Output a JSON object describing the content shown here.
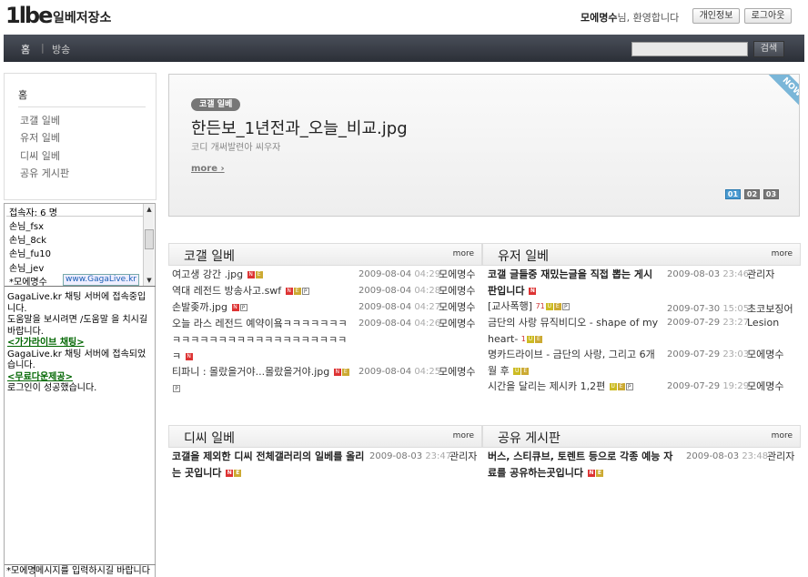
{
  "header": {
    "logo": "1lbe",
    "site_name": "일베저장소",
    "welcome_user": "모에명수",
    "welcome_suffix": "님, 환영합니다",
    "profile_button": "개인정보",
    "logout_button": "로그아웃"
  },
  "nav": {
    "home": "홈",
    "separator": "|",
    "broadcast": "방송",
    "search_button": "검색"
  },
  "sidebar": {
    "home": "홈",
    "items": [
      {
        "label": "코갤 일베"
      },
      {
        "label": "유저 일베"
      },
      {
        "label": "디씨 일베"
      },
      {
        "label": "공유 게시판"
      }
    ]
  },
  "chat": {
    "user_count": "접속자: 6 명",
    "users": [
      "손님_fsx",
      "손님_8ck",
      "손님_fu10",
      "손님_jev",
      "*모에명수"
    ],
    "gagalive_link": "www.GagaLive.kr",
    "messages": {
      "m1": "GagaLive.kr 채팅 서버에 접속중입니다.",
      "m2": "도움말을 보시려면 /도움말 을 치시길 바랍니다.",
      "link1": "<가가라이브 채팅>",
      "m3": "GagaLive.kr 채팅 서버에 접속되었습니다.",
      "link2": "<무료다운제공>",
      "m4": "로그인이 성공했습니다."
    },
    "input_name": "*모에명",
    "input_placeholder": "메시지를 입력하시길 바랍니다"
  },
  "featured": {
    "badge": "코갤 일베",
    "title": "한든보_1년전과_오늘_비교.jpg",
    "subtitle": "코디 개써발련아 씨우자",
    "more": "more ›",
    "ribbon": "NOW",
    "pages": [
      "01",
      "02",
      "03"
    ]
  },
  "boards": {
    "kogal": {
      "title": "코갤 일베",
      "more": "more",
      "rows": [
        {
          "title": "여고생 강간 .jpg",
          "date": "2009-08-04",
          "time": "04:29",
          "author": "모에명수"
        },
        {
          "title": "역대 레전드 방송사고.swf",
          "date": "2009-08-04",
          "time": "04:28",
          "author": "모에명수"
        },
        {
          "title": "손발좆까.jpg",
          "date": "2009-08-04",
          "time": "04:27",
          "author": "모에명수"
        },
        {
          "title": "오늘 라스 레전드 예약이욬ㅋㅋㅋㅋㅋㅋㅋㅋㅋㅋㅋㅋㅋㅋㅋㅋㅋㅋㅋㅋㅋㅋㅋㅋㅋㅋㅋ",
          "date": "2009-08-04",
          "time": "04:26",
          "author": "모에명수"
        },
        {
          "title": "티파니 : 몰랐을거야...몰랐을거야.jpg",
          "date": "2009-08-04",
          "time": "04:25",
          "author": "모에명수"
        }
      ]
    },
    "user": {
      "title": "유저 일베",
      "more": "more",
      "rows": [
        {
          "title": "코갤 글들중 재밌는글을 직접 뽑는 게시판입니다",
          "date": "2009-08-03",
          "time": "23:46",
          "author": "관리자"
        },
        {
          "title": "[교사폭행]",
          "count": "71",
          "date": "2009-07-30",
          "time": "15:05",
          "author": "초코보징어"
        },
        {
          "title": "금단의 사랑 뮤직비디오 - shape of my heart-",
          "count": "1",
          "date": "2009-07-29",
          "time": "23:27",
          "author": "Lesion"
        },
        {
          "title": "명카드라이브 - 금단의 사랑, 그리고 6개월 후",
          "date": "2009-07-29",
          "time": "23:03",
          "author": "모에명수"
        },
        {
          "title": "시간을 달리는 제시카 1,2편",
          "date": "2009-07-29",
          "time": "19:29",
          "author": "모에명수"
        }
      ]
    },
    "dc": {
      "title": "디씨 일베",
      "more": "more",
      "rows": [
        {
          "title": "코갤을 제외한 디씨 전체갤러리의 일베를 올리는 곳입니다",
          "date": "2009-08-03",
          "time": "23:47",
          "author": "관리자"
        }
      ]
    },
    "share": {
      "title": "공유 게시판",
      "more": "more",
      "rows": [
        {
          "title": "버스, 스티큐브, 토렌트 등으로 각종 예능 자료를 공유하는곳입니다",
          "date": "2009-08-03",
          "time": "23:48",
          "author": "관리자"
        }
      ]
    }
  },
  "icons": {
    "new_icon": "N",
    "event_icon": "E",
    "picture_icon": "P",
    "user_icon": "U"
  }
}
